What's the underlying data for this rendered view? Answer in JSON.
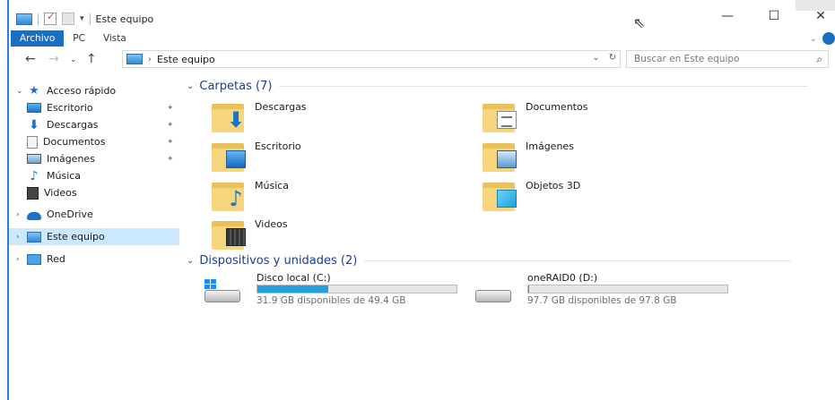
{
  "window": {
    "title": "Este equipo",
    "controls": {
      "minimize": "—",
      "maximize": "☐",
      "close": "✕"
    },
    "quick_access_dropdown": "▾"
  },
  "ribbon": {
    "tabs": [
      {
        "label": "Archivo"
      },
      {
        "label": "PC"
      },
      {
        "label": "Vista"
      }
    ]
  },
  "address": {
    "path": "Este equipo",
    "search_placeholder": "Buscar en Este equipo"
  },
  "nav": {
    "items": [
      {
        "label": "Acceso rápido",
        "icon": "star-icon"
      },
      {
        "label": "Escritorio",
        "icon": "desktop-icon",
        "pinned": true
      },
      {
        "label": "Descargas",
        "icon": "download-icon",
        "pinned": true
      },
      {
        "label": "Documentos",
        "icon": "document-icon",
        "pinned": true
      },
      {
        "label": "Imágenes",
        "icon": "image-icon",
        "pinned": true
      },
      {
        "label": "Música",
        "icon": "music-icon"
      },
      {
        "label": "Videos",
        "icon": "video-icon"
      },
      {
        "label": "OneDrive",
        "icon": "cloud-icon"
      },
      {
        "label": "Este equipo",
        "icon": "pc-icon",
        "selected": true
      },
      {
        "label": "Red",
        "icon": "network-icon"
      }
    ]
  },
  "content": {
    "folders_header": "Carpetas (7)",
    "folders": [
      {
        "label": "Descargas",
        "icon": "download-icon"
      },
      {
        "label": "Documentos",
        "icon": "document-icon"
      },
      {
        "label": "Escritorio",
        "icon": "desktop-icon"
      },
      {
        "label": "Imágenes",
        "icon": "image-icon"
      },
      {
        "label": "Música",
        "icon": "music-icon"
      },
      {
        "label": "Objetos 3D",
        "icon": "cube-icon"
      },
      {
        "label": "Videos",
        "icon": "video-icon"
      }
    ],
    "drives_header": "Dispositivos y unidades (2)",
    "drives": [
      {
        "name": "Disco local (C:)",
        "free_text": "31.9 GB disponibles de 49.4 GB",
        "used_fraction": 0.354,
        "icon": "windows-drive-icon"
      },
      {
        "name": "oneRAID0 (D:)",
        "free_text": "97.7 GB disponibles de 97.8 GB",
        "used_fraction": 0.001,
        "icon": "drive-icon"
      }
    ]
  },
  "colors": {
    "accent": "#1a6fc0",
    "selection": "#cce8ff",
    "drive_bar": "#26a0da",
    "header_text": "#1e3e8a"
  }
}
